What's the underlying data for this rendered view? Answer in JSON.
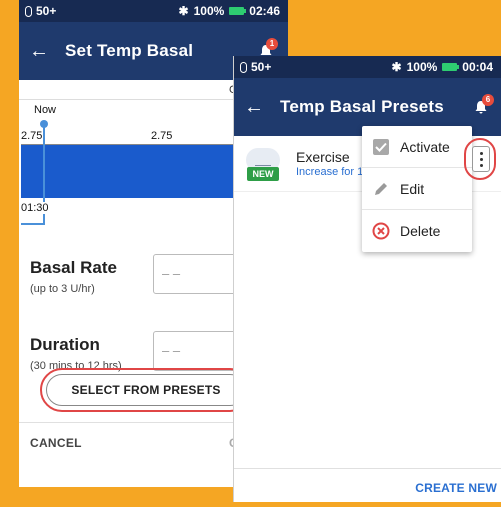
{
  "back_screen": {
    "status": {
      "pod": "50+",
      "bluetooth": "✱",
      "battery_pct": "100%",
      "time": "02:46"
    },
    "appbar": {
      "back": "←",
      "title": "Set Temp Basal",
      "badge": "1"
    },
    "tab_partial": "Gra",
    "graph": {
      "now_label": "Now",
      "value_left": "2.75",
      "value_right": "2.75",
      "time_label": "01:30"
    },
    "basal_rate": {
      "label": "Basal Rate",
      "hint": "(up to 3 U/hr)",
      "placeholder": "– –"
    },
    "duration": {
      "label": "Duration",
      "hint": "(30 mins to 12 hrs)",
      "placeholder": "– –"
    },
    "select_presets_label": "SELECT FROM PRESETS",
    "cancel_label": "CANCEL",
    "confirm_partial": "C"
  },
  "front_screen": {
    "status": {
      "pod": "50+",
      "bluetooth": "✱",
      "battery_pct": "100%",
      "time": "00:04"
    },
    "appbar": {
      "back": "←",
      "title": "Temp Basal Presets",
      "badge": "6"
    },
    "preset": {
      "name": "Exercise",
      "description": "Increase for 1",
      "new_badge": "NEW"
    },
    "menu": {
      "activate": "Activate",
      "edit": "Edit",
      "delete": "Delete"
    },
    "create_new_label": "CREATE NEW"
  },
  "colors": {
    "appbar": "#1f3a6d",
    "statusbar": "#172a52",
    "frame": "#f5a623",
    "highlight": "#e04646",
    "accent": "#2a6fd1",
    "graph_bar": "#1a5bcc"
  }
}
